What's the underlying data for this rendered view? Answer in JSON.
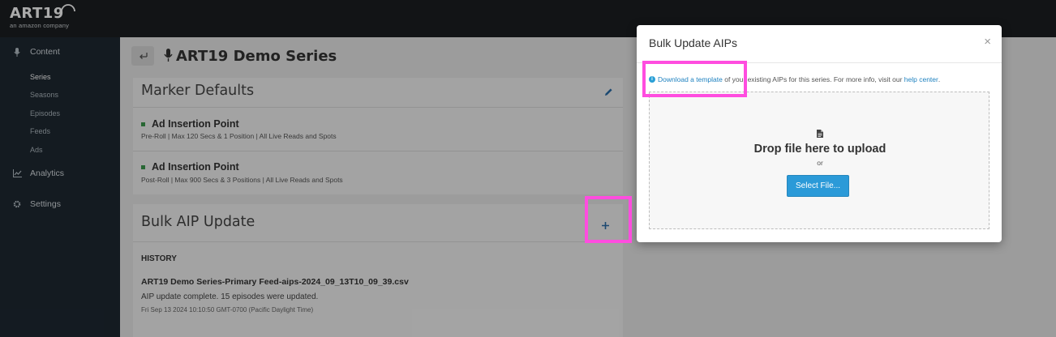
{
  "brand": {
    "logo_text": "ART19",
    "logo_subtext": "an amazon company"
  },
  "sidebar": {
    "sections": [
      {
        "label": "Content",
        "icon": "microphone-icon"
      },
      {
        "label": "Analytics",
        "icon": "chart-icon"
      },
      {
        "label": "Settings",
        "icon": "gear-icon"
      }
    ],
    "content_items": [
      {
        "label": "Series",
        "active": true
      },
      {
        "label": "Seasons"
      },
      {
        "label": "Episodes"
      },
      {
        "label": "Feeds"
      },
      {
        "label": "Ads"
      }
    ]
  },
  "header": {
    "back_icon": "back-arrow-icon",
    "title": "ART19 Demo Series"
  },
  "marker_defaults": {
    "title": "Marker Defaults",
    "items": [
      {
        "title": "Ad Insertion Point",
        "desc": "Pre-Roll | Max 120 Secs & 1 Position  |  All Live Reads and Spots"
      },
      {
        "title": "Ad Insertion Point",
        "desc": "Post-Roll | Max 900 Secs & 3 Positions  |  All Live Reads and Spots"
      }
    ]
  },
  "bulk": {
    "title": "Bulk AIP Update",
    "history_label": "HISTORY",
    "file_name": "ART19 Demo Series-Primary Feed-aips-2024_09_13T10_09_39.csv",
    "file_message": "AIP update complete. 15 episodes were updated.",
    "file_time": "Fri Sep 13 2024 10:10:50 GMT-0700 (Pacific Daylight Time)"
  },
  "modal": {
    "title": "Bulk Update AIPs",
    "close": "×",
    "info_icon": "i",
    "download_link": "Download a template",
    "info_middle": " of your existing AIPs for this series. For more info, visit our ",
    "help_link": "help center",
    "info_end": ".",
    "drop_text": "Drop file here to upload",
    "or_text": "or",
    "select_button": "Select File..."
  },
  "colors": {
    "topbar": "#1b1f22",
    "sidebar": "#1e2932",
    "accent": "#2b9ad8",
    "link": "#1f82c0",
    "highlight": "#ff4ddf",
    "marker_green": "#3c9a4e"
  }
}
